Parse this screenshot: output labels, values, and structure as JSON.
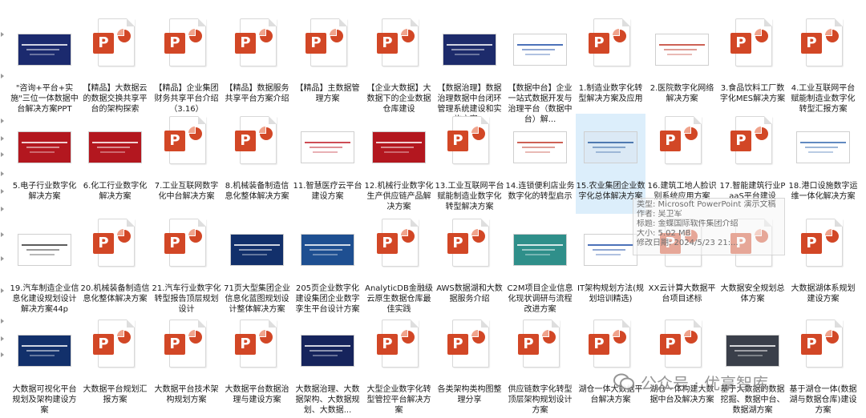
{
  "files": [
    {
      "label": "\"咨询+平台+实施\"三位一体数据中台解决方案PPT",
      "thumb": "image",
      "bg": "#1b2a6e",
      "accent": "#ffffff",
      "slide_text": "\"咨询+平台+实施\"三位一体数据中台解决方案"
    },
    {
      "label": "【精品】大数据云的数据交换共享平台的架构探索",
      "thumb": "ppt"
    },
    {
      "label": "【精品】企业集团财务共享平台介绍（3.16）",
      "thumb": "ppt"
    },
    {
      "label": "【精品】数据服务共享平台方案介绍",
      "thumb": "ppt"
    },
    {
      "label": "【精品】主数据管理方案",
      "thumb": "ppt"
    },
    {
      "label": "【企业大数据】大数据下的企业数据仓库建设",
      "thumb": "ppt"
    },
    {
      "label": "【数据治理】数据治理数据中台闭环管理系统建设和实施方案...",
      "thumb": "image",
      "bg": "#1d2b6b",
      "accent": "#ffffff",
      "slide_text": ""
    },
    {
      "label": "【数据中台】企业一站式数据开发与治理平台（数据中台）解...",
      "thumb": "image",
      "bg": "#ffffff",
      "accent": "#1f4fa8",
      "slide_text": "企业一站式数据开发与治理平台"
    },
    {
      "label": "1.制造业数字化转型解决方案及应用",
      "thumb": "ppt"
    },
    {
      "label": "2.医院数字化网络解决方案",
      "thumb": "image",
      "bg": "#ffffff",
      "accent": "#c0392b",
      "slide_text": "数字化医院解决方案"
    },
    {
      "label": "3.食品饮料工厂数字化MES解决方案",
      "thumb": "ppt"
    },
    {
      "label": "4.工业互联网平台赋能制造业数字化转型汇报方案",
      "thumb": "ppt"
    },
    {
      "label": "5.电子行业数字化解决方案",
      "thumb": "image",
      "bg": "#b3171f",
      "accent": "#ffffff",
      "slide_text": "电子行业数字化解决方案"
    },
    {
      "label": "6.化工行业数字化解决方案",
      "thumb": "image",
      "bg": "#b3171f",
      "accent": "#ffffff",
      "slide_text": "化工行业数字化解决方案"
    },
    {
      "label": "7.工业互联网数字化中台解决方案",
      "thumb": "ppt"
    },
    {
      "label": "8.机械装备制造信息化整体解决方案",
      "thumb": "ppt"
    },
    {
      "label": "11.智慧医疗云平台建设方案",
      "thumb": "image",
      "bg": "#ffffff",
      "accent": "#c0202a",
      "slide_text": "智慧医疗云平台建设方案"
    },
    {
      "label": "12.机械行业数字化生产供应链产品解决方案",
      "thumb": "image",
      "bg": "#b3171f",
      "accent": "#ffffff",
      "slide_text": "机械行业数字化生产供应链"
    },
    {
      "label": "13.工业互联网平台赋能制造业数字化转型解决方案",
      "thumb": "ppt"
    },
    {
      "label": "14.连锁便利店业务数字化的转型启示",
      "thumb": "image",
      "bg": "#ffffff",
      "accent": "#c0392b",
      "slide_text": "连锁便利店业务数字化"
    },
    {
      "label": "15.农业集团企业数字化总体解决方案",
      "thumb": "image",
      "bg": "#dbe9f5",
      "accent": "#2a5d9f",
      "slide_text": "金蝶现代农业解决方案",
      "selected": true
    },
    {
      "label": "16.建筑工地人脸识别系统应用方案",
      "thumb": "ppt"
    },
    {
      "label": "17.智能建筑行业PaaS平台建设",
      "thumb": "ppt"
    },
    {
      "label": "18.港口设施数字运维一体化解决方案",
      "thumb": "image",
      "bg": "#ffffff",
      "accent": "#3a6db0",
      "slide_text": "港口设施数字运维一体化解决方案"
    },
    {
      "label": "19.汽车制造企业信息化建设规划设计解决方案44p",
      "thumb": "image",
      "bg": "#ffffff",
      "accent": "#333333",
      "slide_text": "汽车制造企业信息化"
    },
    {
      "label": "20.机械装备制造信息化整体解决方案",
      "thumb": "ppt"
    },
    {
      "label": "21.汽车行业数字化转型报告顶层规划设计",
      "thumb": "ppt"
    },
    {
      "label": "71页大型集团企业信息化蓝图规划设计整体解决方案",
      "thumb": "image",
      "bg": "#12306b",
      "accent": "#ffffff",
      "slide_text": "大型集团企业信息化蓝图规划"
    },
    {
      "label": "205页企业数字化建设集团企业数字孪生平台设计方案",
      "thumb": "image",
      "bg": "#1e4f91",
      "accent": "#ffffff",
      "slide_text": "集团企业数字孪生平台"
    },
    {
      "label": "AnalyticDB金融级云原生数据仓库最佳实践",
      "thumb": "ppt"
    },
    {
      "label": "AWS数据湖和大数据服务介绍",
      "thumb": "ppt"
    },
    {
      "label": "C2M项目企业信息化现状调研与流程改进方案",
      "thumb": "image",
      "bg": "#2f8f8a",
      "accent": "#ffffff",
      "slide_text": "企业信息化现状调研"
    },
    {
      "label": "IT架构规划方法(规划培训精选)",
      "thumb": "image",
      "bg": "#ffffff",
      "accent": "#1f4fa8",
      "slide_text": "IT架构规划方法"
    },
    {
      "label": "XX云计算大数据平台项目述标",
      "thumb": "ppt"
    },
    {
      "label": "大数据安全规划总体方案",
      "thumb": "ppt"
    },
    {
      "label": "大数据湖体系规划建设方案",
      "thumb": "ppt"
    },
    {
      "label": "大数据可视化平台规划及架构建设方案",
      "thumb": "image",
      "bg": "#12306b",
      "accent": "#ffffff",
      "slide_text": "大数据可视化平台规划及架构建设方案"
    },
    {
      "label": "大数据平台规划汇报方案",
      "thumb": "ppt"
    },
    {
      "label": "大数据平台技术架构规划方案",
      "thumb": "ppt"
    },
    {
      "label": "大数据平台数据治理与建设方案",
      "thumb": "ppt"
    },
    {
      "label": "大数据治理、大数据架构、大数据规划、大数据...",
      "thumb": "image",
      "bg": "#16245c",
      "accent": "#ffffff",
      "slide_text": "大数据治理、大数据架构、大数据规划"
    },
    {
      "label": "大型企业数字化转型管控平台解决方案",
      "thumb": "ppt"
    },
    {
      "label": "各类架构类构图整理分享",
      "thumb": "ppt"
    },
    {
      "label": "供应链数字化转型顶层架构规划设计方案",
      "thumb": "ppt"
    },
    {
      "label": "湖仓一体大数据平台解决方案",
      "thumb": "ppt"
    },
    {
      "label": "湖仓一体构建大数据中台及解决方案",
      "thumb": "ppt"
    },
    {
      "label": "基于大数据的数据挖掘、数据中台、数据湖方案",
      "thumb": "image",
      "bg": "#3a3f4a",
      "accent": "#ffffff",
      "slide_text": "数据挖掘、数据中台、数据湖"
    },
    {
      "label": "基于湖仓一体(数据湖与数据仓库)建设方案",
      "thumb": "ppt"
    }
  ],
  "tooltip": {
    "type": "类型: Microsoft PowerPoint 演示文稿",
    "author": "作者: 吴卫军",
    "title": "标题: 金蝶国际软件集团介绍",
    "size": "大小: 5.02 MB",
    "modified": "修改日期: 2024/5/23 21:..."
  },
  "watermark": {
    "text": "公众号 · 优享智库"
  },
  "colors": {
    "ppt_red": "#d24726",
    "selection": "#dceefb"
  }
}
